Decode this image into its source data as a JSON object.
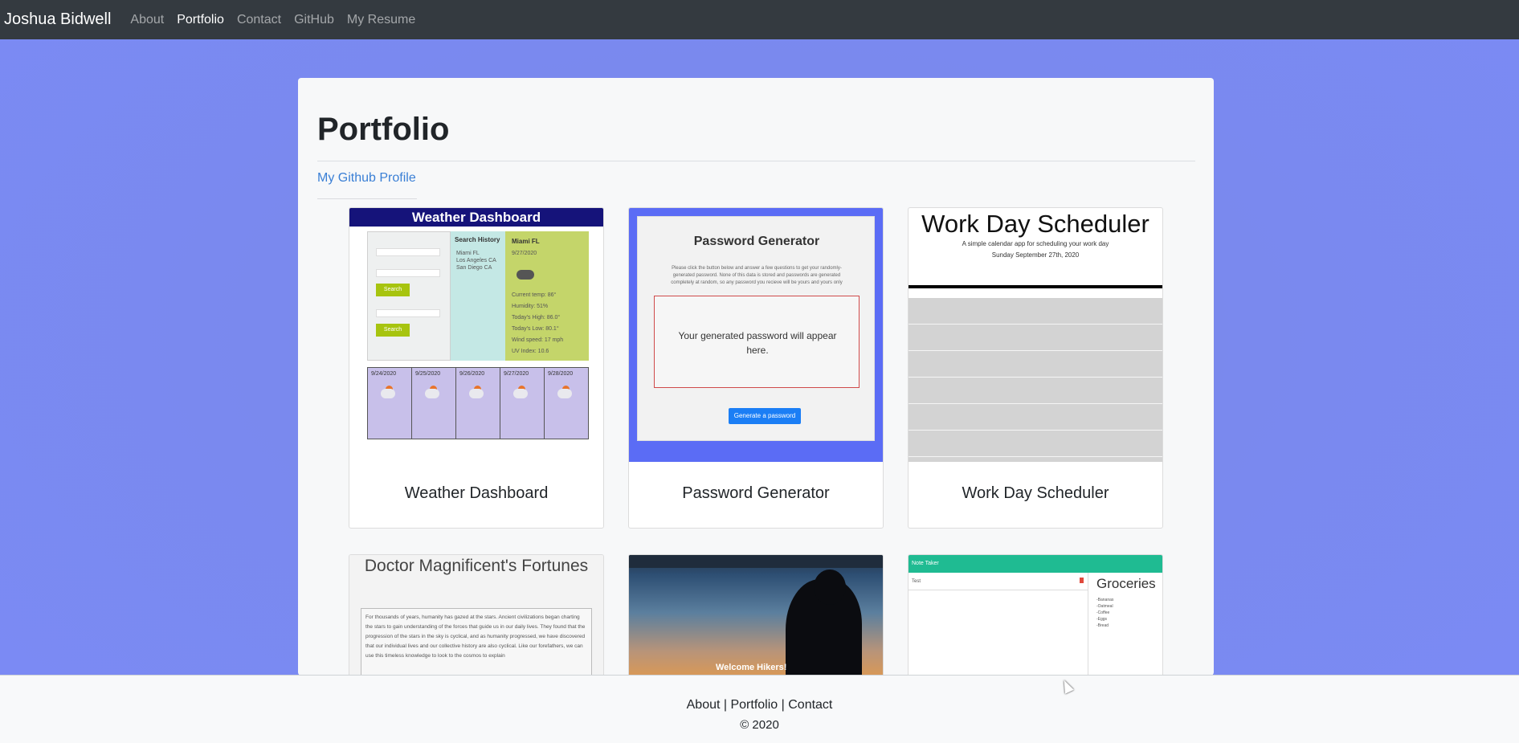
{
  "navbar": {
    "brand": "Joshua Bidwell",
    "links": [
      "About",
      "Portfolio",
      "Contact",
      "GitHub",
      "My Resume"
    ],
    "active": "Portfolio"
  },
  "main": {
    "title": "Portfolio",
    "github_link": "My Github Profile",
    "projects": [
      {
        "title": "Weather Dashboard"
      },
      {
        "title": "Password Generator"
      },
      {
        "title": "Work Day Scheduler"
      },
      {
        "title": "Doctor Magnificent's Fortunes"
      },
      {
        "title": "Welcome Hikers!"
      },
      {
        "title": "Note Taker"
      }
    ]
  },
  "weather_shot": {
    "heading": "Weather Dashboard",
    "history_title": "Search History",
    "history": [
      "Miami FL",
      "Los Angeles CA",
      "San Diego CA"
    ],
    "city": "Miami FL",
    "date": "9/27/2020",
    "search_label": "Search",
    "current": [
      "Current temp: 86°",
      "Humidity: 51%",
      "Today's High: 86.0°",
      "Today's Low: 80.1°",
      "Wind speed: 17 mph",
      "UV Index: 10.6"
    ],
    "days": [
      "9/24/2020",
      "9/25/2020",
      "9/26/2020",
      "9/27/2020",
      "9/28/2020"
    ]
  },
  "password_shot": {
    "heading": "Password Generator",
    "instructions": "Please click the button below and answer a few questions to get your randomly-generated password. None of this data is stored and passwords are generated completely at random, so any password you recieve will be yours and yours only",
    "placeholder": "Your generated password will appear here.",
    "button": "Generate a password"
  },
  "scheduler_shot": {
    "heading": "Work Day Scheduler",
    "subtitle": "A simple calendar app for scheduling your work day",
    "date": "Sunday September 27th, 2020"
  },
  "fortunes_shot": {
    "heading": "Doctor Magnificent's Fortunes",
    "body": "For thousands of years, humanity has gazed at the stars. Ancient civilizations began charting the stars to gain understanding of the forces that guide us in our daily lives. They found that the progression of the stars in the sky is cyclical, and as humanity progressed, we have discovered that our individual lives and our collective history are also cyclical. Like our forefathers, we can use this timeless knowledge to look to the cosmos to explain"
  },
  "hikers_shot": {
    "heading": "Welcome Hikers!"
  },
  "notes_shot": {
    "header": "Note Taker",
    "note": "Test",
    "title": "Groceries",
    "items": [
      "-Bananas",
      "-Oatmeal",
      "-Coffee",
      "-Eggs",
      "-Bread"
    ]
  },
  "footer": {
    "about": "About",
    "portfolio": "Portfolio",
    "contact": "Contact",
    "sep": " | ",
    "copyright": "© 2020"
  }
}
